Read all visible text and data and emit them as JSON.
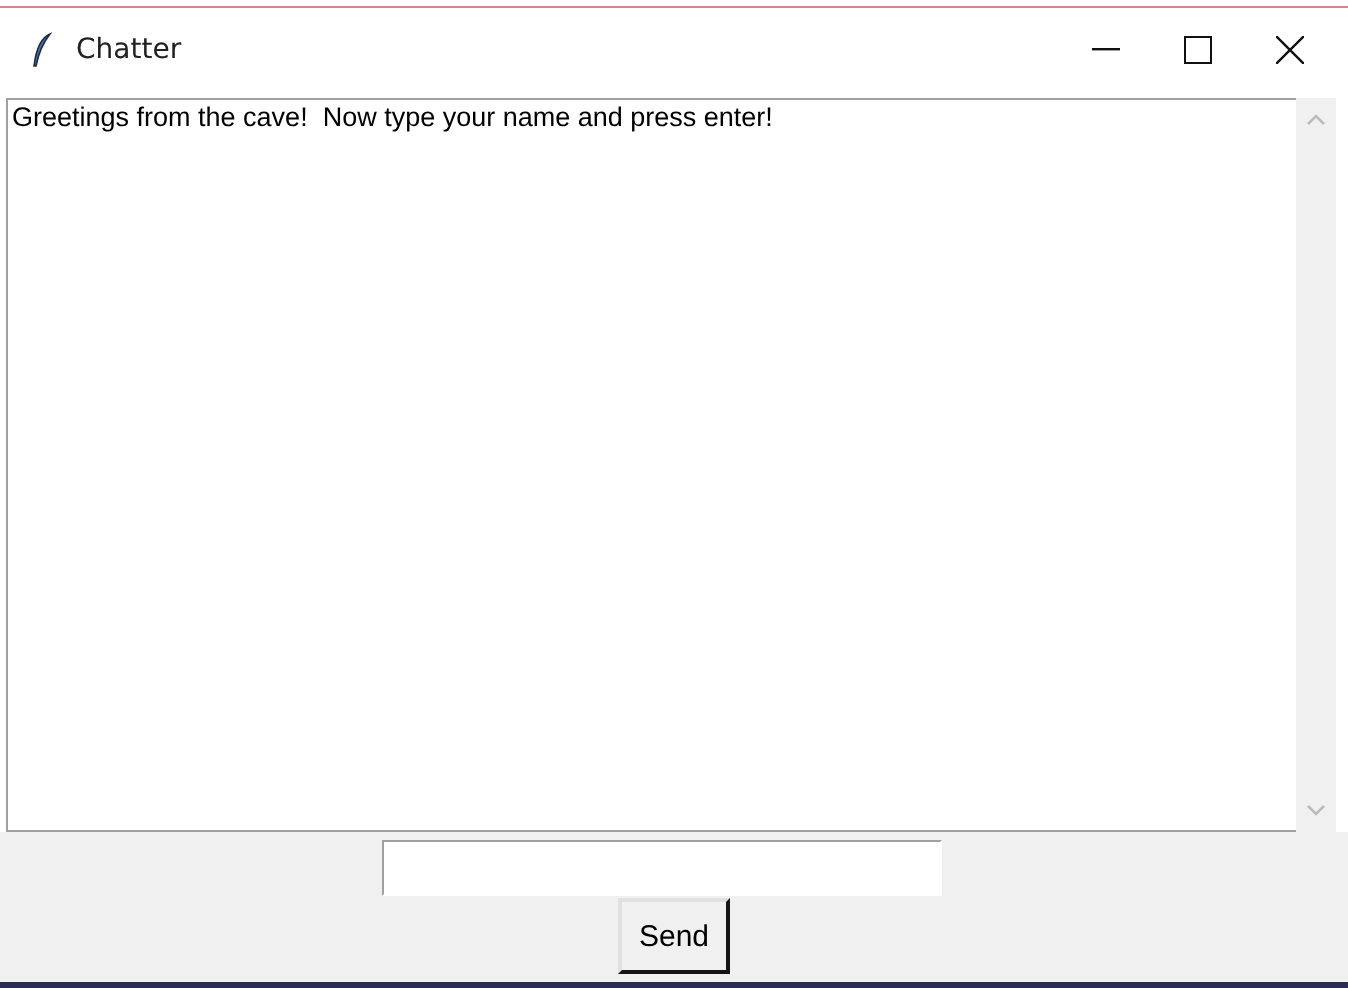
{
  "window": {
    "title": "Chatter"
  },
  "messages": [
    "Greetings from the cave!  Now type your name and press enter!"
  ],
  "send_button": {
    "label": "Send"
  }
}
